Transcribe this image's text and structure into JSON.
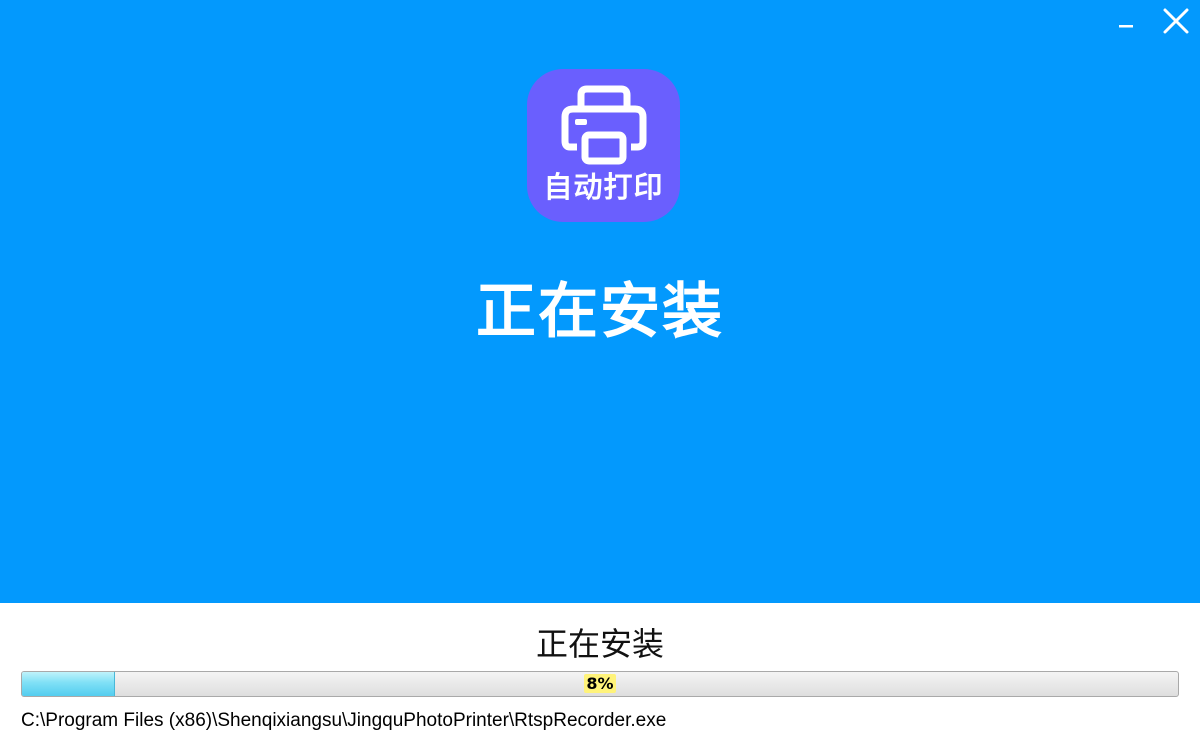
{
  "window": {
    "minimize_label": "minimize",
    "close_label": "close"
  },
  "app": {
    "icon_text": "自动打印",
    "icon_name": "printer-icon"
  },
  "hero": {
    "title": "正在安装"
  },
  "install": {
    "status": "正在安装",
    "progress_percent": 8,
    "progress_label": "8%",
    "current_file": "C:\\Program Files (x86)\\Shenqixiangsu\\JingquPhotoPrinter\\RtspRecorder.exe"
  },
  "colors": {
    "hero_background": "#0399fd",
    "icon_background": "#6a5ffe",
    "progress_fill": "#7fe0f6",
    "label_highlight": "#fff37a"
  }
}
